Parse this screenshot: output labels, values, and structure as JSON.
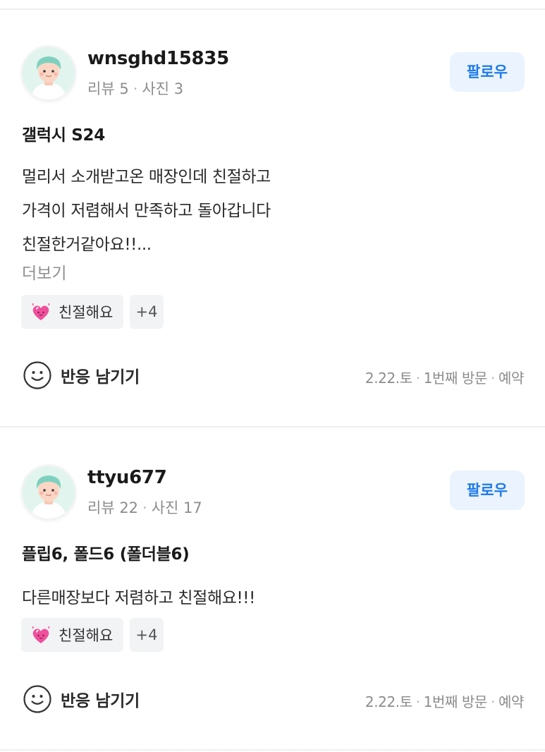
{
  "reviews": [
    {
      "username": "wnsghd15835",
      "meta": {
        "reviews": "리뷰 5",
        "photos": "사진 3"
      },
      "follow_label": "팔로우",
      "product": "갤럭시 S24",
      "lines": [
        "멀리서 소개받고온 매장인데 친절하고",
        "가격이 저렴해서 만족하고 돌아갑니다",
        "친절한거같아요!!..."
      ],
      "more_label": "더보기",
      "tag": "친절해요",
      "tag_more": "+4",
      "react_label": "반응 남기기",
      "visit": {
        "date": "2.22.토",
        "count": "1번째 방문",
        "type": "예약"
      }
    },
    {
      "username": "ttyu677",
      "meta": {
        "reviews": "리뷰 22",
        "photos": "사진 17"
      },
      "follow_label": "팔로우",
      "product": "플립6, 폴드6 (폴더블6)",
      "lines": [
        "다른매장보다 저렴하고 친절해요!!!"
      ],
      "tag": "친절해요",
      "tag_more": "+4",
      "react_label": "반응 남기기",
      "visit": {
        "date": "2.22.토",
        "count": "1번째 방문",
        "type": "예약"
      }
    }
  ],
  "colors": {
    "accent": "#1f7be8",
    "follow_bg": "#eaf3fe",
    "chip_bg": "#f2f3f5",
    "muted": "#8c8c8c",
    "divider": "#eef0f2"
  }
}
